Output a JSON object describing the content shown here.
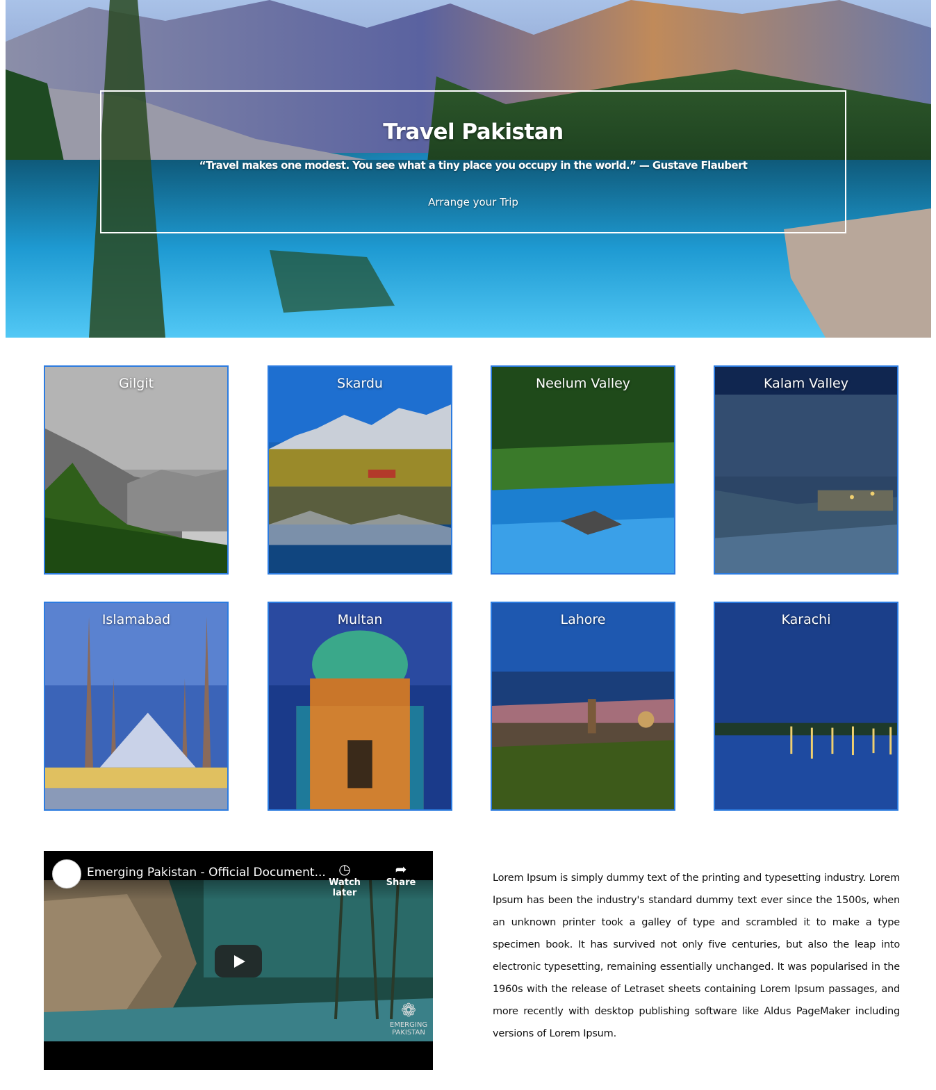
{
  "hero": {
    "title": "Travel Pakistan",
    "quote": "“Travel makes one modest. You see what a tiny place you occupy in the world.” — Gustave Flaubert",
    "cta": "Arrange your Trip"
  },
  "destinations": [
    {
      "name": "Gilgit"
    },
    {
      "name": "Skardu"
    },
    {
      "name": "Neelum Valley"
    },
    {
      "name": "Kalam Valley"
    },
    {
      "name": "Islamabad"
    },
    {
      "name": "Multan"
    },
    {
      "name": "Lahore"
    },
    {
      "name": "Karachi"
    }
  ],
  "video": {
    "title": "Emerging Pakistan - Official Document...",
    "watch_later": "Watch later",
    "share": "Share",
    "watermark_line1": "EMERGING",
    "watermark_line2": "PAKISTAN"
  },
  "about": {
    "text": "Lorem Ipsum is simply dummy text of the printing and typesetting industry. Lorem Ipsum has been the industry's standard dummy text ever since the 1500s, when an unknown printer took a galley of type and scrambled it to make a type specimen book. It has survived not only five centuries, but also the leap into electronic typesetting, remaining essentially unchanged. It was popularised in the 1960s with the release of Letraset sheets containing Lorem Ipsum passages, and more recently with desktop publishing software like Aldus PageMaker including versions of Lorem Ipsum."
  },
  "colors": {
    "card_border": "#2b7be0",
    "lake": "#1ea0d8"
  }
}
